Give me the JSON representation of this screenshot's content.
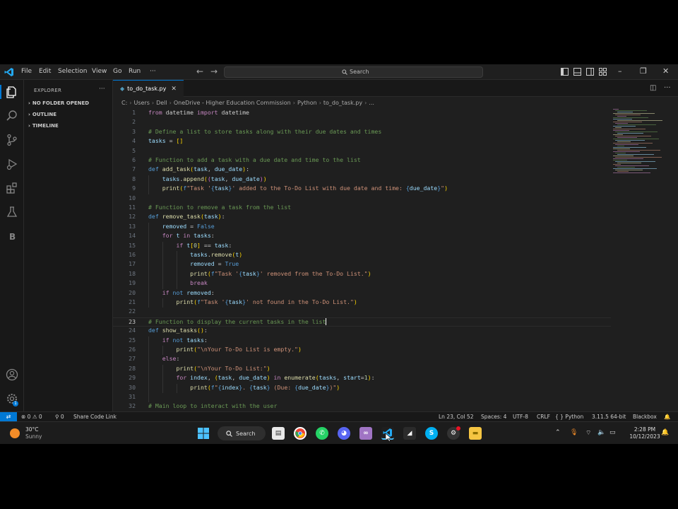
{
  "titlebar": {
    "menus": [
      "File",
      "Edit",
      "Selection",
      "View",
      "Go",
      "Run",
      "···"
    ],
    "search_label": "Search"
  },
  "sidebar": {
    "title": "EXPLORER",
    "more": "···",
    "sections": [
      "NO FOLDER OPENED",
      "OUTLINE",
      "TIMELINE"
    ]
  },
  "tab": {
    "filename": "to_do_task.py",
    "close": "✕"
  },
  "breadcrumb": [
    "C:",
    "Users",
    "Dell",
    "OneDrive - Higher Education Commission",
    "Python",
    "to_do_task.py",
    "..."
  ],
  "editor": {
    "current_line": 23,
    "lines": [
      {
        "n": "1"
      },
      {
        "n": "2"
      },
      {
        "n": "3"
      },
      {
        "n": "4"
      },
      {
        "n": "5"
      },
      {
        "n": "6"
      },
      {
        "n": "7"
      },
      {
        "n": "8"
      },
      {
        "n": "9"
      },
      {
        "n": "10"
      },
      {
        "n": "11"
      },
      {
        "n": "12"
      },
      {
        "n": "13"
      },
      {
        "n": "14"
      },
      {
        "n": "15"
      },
      {
        "n": "16"
      },
      {
        "n": "17"
      },
      {
        "n": "18"
      },
      {
        "n": "19"
      },
      {
        "n": "20"
      },
      {
        "n": "21"
      },
      {
        "n": "22"
      },
      {
        "n": "23"
      },
      {
        "n": "24"
      },
      {
        "n": "25"
      },
      {
        "n": "26"
      },
      {
        "n": "27"
      },
      {
        "n": "28"
      },
      {
        "n": "29"
      },
      {
        "n": "30"
      },
      {
        "n": "31"
      },
      {
        "n": "32"
      }
    ],
    "tokens": [
      [
        [
          "kw",
          "from"
        ],
        [
          "",
          ""
        ],
        [
          "",
          "datetime"
        ],
        [
          "",
          ""
        ],
        [
          "kw",
          "import"
        ],
        [
          "",
          ""
        ],
        [
          "",
          "datetime"
        ]
      ],
      [],
      [
        [
          "cm",
          "# Define a list to store tasks along with their due dates and times"
        ]
      ],
      [
        [
          "vr",
          "tasks"
        ],
        [
          "",
          " = "
        ],
        [
          "br1",
          "[]"
        ]
      ],
      [],
      [
        [
          "cm",
          "# Function to add a task with a due date and time to the list"
        ]
      ],
      [
        [
          "kb",
          "def"
        ],
        [
          "",
          " "
        ],
        [
          "fn",
          "add_task"
        ],
        [
          "br1",
          "("
        ],
        [
          "vr",
          "task"
        ],
        [
          "",
          ", "
        ],
        [
          "vr",
          "due_date"
        ],
        [
          "br1",
          ")"
        ],
        [
          "",
          ":"
        ]
      ],
      [
        [
          "",
          "    "
        ],
        [
          "vr",
          "tasks"
        ],
        [
          "",
          "."
        ],
        [
          "fn",
          "append"
        ],
        [
          "br1",
          "("
        ],
        [
          "br2",
          "("
        ],
        [
          "vr",
          "task"
        ],
        [
          "",
          ", "
        ],
        [
          "vr",
          "due_date"
        ],
        [
          "br2",
          ")"
        ],
        [
          "br1",
          ")"
        ]
      ],
      [
        [
          "",
          "    "
        ],
        [
          "fn",
          "print"
        ],
        [
          "br1",
          "("
        ],
        [
          "kb",
          "f"
        ],
        [
          "st",
          "\"Task '"
        ],
        [
          "kb",
          "{"
        ],
        [
          "vr",
          "task"
        ],
        [
          "kb",
          "}"
        ],
        [
          "st",
          "' added to the To-Do List with due date and time: "
        ],
        [
          "kb",
          "{"
        ],
        [
          "vr",
          "due_date"
        ],
        [
          "kb",
          "}"
        ],
        [
          "st",
          "\""
        ],
        [
          "br1",
          ")"
        ]
      ],
      [],
      [
        [
          "cm",
          "# Function to remove a task from the list"
        ]
      ],
      [
        [
          "kb",
          "def"
        ],
        [
          "",
          " "
        ],
        [
          "fn",
          "remove_task"
        ],
        [
          "br1",
          "("
        ],
        [
          "vr",
          "task"
        ],
        [
          "br1",
          ")"
        ],
        [
          "",
          ":"
        ]
      ],
      [
        [
          "",
          "    "
        ],
        [
          "vr",
          "removed"
        ],
        [
          "",
          " = "
        ],
        [
          "kb",
          "False"
        ]
      ],
      [
        [
          "",
          "    "
        ],
        [
          "kw",
          "for"
        ],
        [
          "",
          " "
        ],
        [
          "vr",
          "t"
        ],
        [
          "",
          " "
        ],
        [
          "kw",
          "in"
        ],
        [
          "",
          " "
        ],
        [
          "vr",
          "tasks"
        ],
        [
          "",
          ":"
        ]
      ],
      [
        [
          "",
          "        "
        ],
        [
          "kw",
          "if"
        ],
        [
          "",
          " "
        ],
        [
          "vr",
          "t"
        ],
        [
          "br1",
          "["
        ],
        [
          "nm",
          "0"
        ],
        [
          "br1",
          "]"
        ],
        [
          "",
          " == "
        ],
        [
          "vr",
          "task"
        ],
        [
          "",
          ":"
        ]
      ],
      [
        [
          "",
          "            "
        ],
        [
          "vr",
          "tasks"
        ],
        [
          "",
          "."
        ],
        [
          "fn",
          "remove"
        ],
        [
          "br1",
          "("
        ],
        [
          "vr",
          "t"
        ],
        [
          "br1",
          ")"
        ]
      ],
      [
        [
          "",
          "            "
        ],
        [
          "vr",
          "removed"
        ],
        [
          "",
          " = "
        ],
        [
          "kb",
          "True"
        ]
      ],
      [
        [
          "",
          "            "
        ],
        [
          "fn",
          "print"
        ],
        [
          "br1",
          "("
        ],
        [
          "kb",
          "f"
        ],
        [
          "st",
          "\"Task '"
        ],
        [
          "kb",
          "{"
        ],
        [
          "vr",
          "task"
        ],
        [
          "kb",
          "}"
        ],
        [
          "st",
          "' removed from the To-Do List.\""
        ],
        [
          "br1",
          ")"
        ]
      ],
      [
        [
          "",
          "            "
        ],
        [
          "kw",
          "break"
        ]
      ],
      [
        [
          "",
          "    "
        ],
        [
          "kw",
          "if"
        ],
        [
          "",
          " "
        ],
        [
          "kb",
          "not"
        ],
        [
          "",
          " "
        ],
        [
          "vr",
          "removed"
        ],
        [
          "",
          ":"
        ]
      ],
      [
        [
          "",
          "        "
        ],
        [
          "fn",
          "print"
        ],
        [
          "br1",
          "("
        ],
        [
          "kb",
          "f"
        ],
        [
          "st",
          "\"Task '"
        ],
        [
          "kb",
          "{"
        ],
        [
          "vr",
          "task"
        ],
        [
          "kb",
          "}"
        ],
        [
          "st",
          "' not found in the To-Do List.\""
        ],
        [
          "br1",
          ")"
        ]
      ],
      [],
      [
        [
          "cm",
          "# Function to display the current tasks in the list"
        ]
      ],
      [
        [
          "kb",
          "def"
        ],
        [
          "",
          " "
        ],
        [
          "fn",
          "show_tasks"
        ],
        [
          "br1",
          "()"
        ],
        [
          "",
          ":"
        ]
      ],
      [
        [
          "",
          "    "
        ],
        [
          "kw",
          "if"
        ],
        [
          "",
          " "
        ],
        [
          "kb",
          "not"
        ],
        [
          "",
          " "
        ],
        [
          "vr",
          "tasks"
        ],
        [
          "",
          ":"
        ]
      ],
      [
        [
          "",
          "        "
        ],
        [
          "fn",
          "print"
        ],
        [
          "br1",
          "("
        ],
        [
          "st",
          "\"\\nYour To-Do List is empty.\""
        ],
        [
          "br1",
          ")"
        ]
      ],
      [
        [
          "",
          "    "
        ],
        [
          "kw",
          "else"
        ],
        [
          "",
          ":"
        ]
      ],
      [
        [
          "",
          "        "
        ],
        [
          "fn",
          "print"
        ],
        [
          "br1",
          "("
        ],
        [
          "st",
          "\"\\nYour To-Do List:\""
        ],
        [
          "br1",
          ")"
        ]
      ],
      [
        [
          "",
          "        "
        ],
        [
          "kw",
          "for"
        ],
        [
          "",
          " "
        ],
        [
          "vr",
          "index"
        ],
        [
          "",
          ", "
        ],
        [
          "br1",
          "("
        ],
        [
          "vr",
          "task"
        ],
        [
          "",
          ", "
        ],
        [
          "vr",
          "due_date"
        ],
        [
          "br1",
          ")"
        ],
        [
          "",
          " "
        ],
        [
          "kw",
          "in"
        ],
        [
          "",
          " "
        ],
        [
          "fn",
          "enumerate"
        ],
        [
          "br1",
          "("
        ],
        [
          "vr",
          "tasks"
        ],
        [
          "",
          ", "
        ],
        [
          "vr",
          "start"
        ],
        [
          "",
          "="
        ],
        [
          "nm",
          "1"
        ],
        [
          "br1",
          ")"
        ],
        [
          "",
          ":"
        ]
      ],
      [
        [
          "",
          "            "
        ],
        [
          "fn",
          "print"
        ],
        [
          "br1",
          "("
        ],
        [
          "kb",
          "f"
        ],
        [
          "st",
          "\""
        ],
        [
          "kb",
          "{"
        ],
        [
          "vr",
          "index"
        ],
        [
          "kb",
          "}"
        ],
        [
          "st",
          ". "
        ],
        [
          "kb",
          "{"
        ],
        [
          "vr",
          "task"
        ],
        [
          "kb",
          "}"
        ],
        [
          "st",
          " (Due: "
        ],
        [
          "kb",
          "{"
        ],
        [
          "vr",
          "due_date"
        ],
        [
          "kb",
          "}"
        ],
        [
          "st",
          ")\""
        ],
        [
          "br1",
          ")"
        ]
      ],
      [],
      [
        [
          "cm",
          "# Main loop to interact with the user"
        ]
      ]
    ]
  },
  "statusbar": {
    "problems": "⊗ 0 ⚠ 0",
    "ports": "⚲ 0",
    "share": "Share Code Link",
    "position": "Ln 23, Col 52",
    "spaces": "Spaces: 4",
    "encoding": "UTF-8",
    "eol": "CRLF",
    "language": "{ } Python",
    "interpreter": "3.11.5 64-bit",
    "blackbox": "Blackbox",
    "bell": "🔔"
  },
  "taskbar": {
    "weather_temp": "30°C",
    "weather_desc": "Sunny",
    "search_label": "Search",
    "time": "2:28 PM",
    "date": "10/12/2023",
    "colors": {
      "start": "#4cc2ff",
      "chrome": "#ea4335",
      "whatsapp": "#25d366",
      "discord": "#5865f2",
      "vs": "#a074c4",
      "vscode": "#23a9f2",
      "skype": "#00aff0",
      "explorer": "#f5c542"
    }
  }
}
